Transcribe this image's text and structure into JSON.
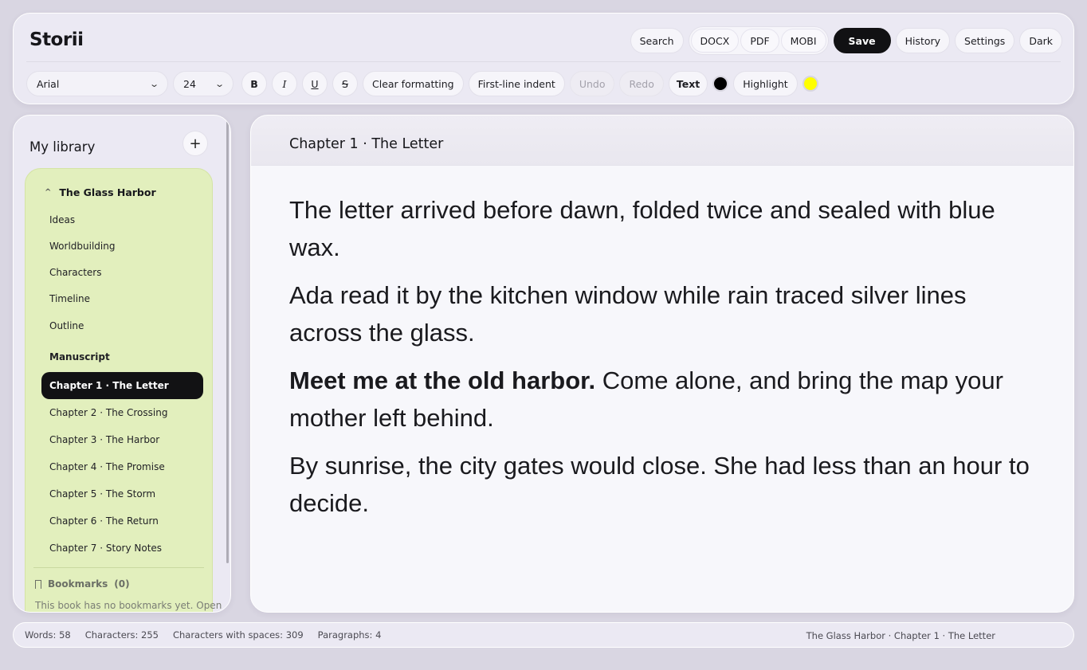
{
  "app": {
    "name": "Storii"
  },
  "actions": {
    "search": "Search",
    "export": [
      "DOCX",
      "PDF",
      "MOBI"
    ],
    "save": "Save",
    "history": "History",
    "settings": "Settings",
    "theme": "Dark"
  },
  "toolbar": {
    "font_family": "Arial",
    "font_size": "24",
    "bold": "B",
    "italic": "I",
    "underline": "U",
    "strike": "S",
    "clear_formatting": "Clear formatting",
    "first_line_indent": "First-line indent",
    "undo": "Undo",
    "redo": "Redo",
    "text_color_label": "Text",
    "text_color": "#000000",
    "highlight_label": "Highlight",
    "highlight_color": "#ffff00"
  },
  "sidebar": {
    "title": "My library",
    "add_icon": "+",
    "book": {
      "title": "The Glass Harbor",
      "sections": [
        "Ideas",
        "Worldbuilding",
        "Characters",
        "Timeline",
        "Outline"
      ],
      "manuscript_label": "Manuscript",
      "chapters": [
        "Chapter 1 · The Letter",
        "Chapter 2 · The Crossing",
        "Chapter 3 · The Harbor",
        "Chapter 4 · The Promise",
        "Chapter 5 · The Storm",
        "Chapter 6 · The Return",
        "Chapter 7 · Story Notes"
      ],
      "active_chapter": "Chapter 1 · The Letter"
    },
    "bookmarks": {
      "title": "Bookmarks",
      "count": "(0)",
      "empty_text": "This book has no bookmarks yet. Open"
    }
  },
  "editor": {
    "chapter_title": "Chapter 1 · The Letter",
    "paragraphs": [
      {
        "bold": "",
        "text": "The letter arrived before dawn, folded twice and sealed with blue wax."
      },
      {
        "bold": "",
        "text": "Ada read it by the kitchen window while rain traced silver lines across the glass."
      },
      {
        "bold": "Meet me at the old harbor.",
        "text": " Come alone, and bring the map your mother left behind."
      },
      {
        "bold": "",
        "text": "By sunrise, the city gates would close. She had less than an hour to decide."
      }
    ]
  },
  "status": {
    "words": "Words: 58",
    "characters": "Characters: 255",
    "characters_spaces": "Characters with spaces: 309",
    "paragraphs": "Paragraphs: 4",
    "location": "The Glass Harbor · Chapter 1 · The Letter"
  }
}
